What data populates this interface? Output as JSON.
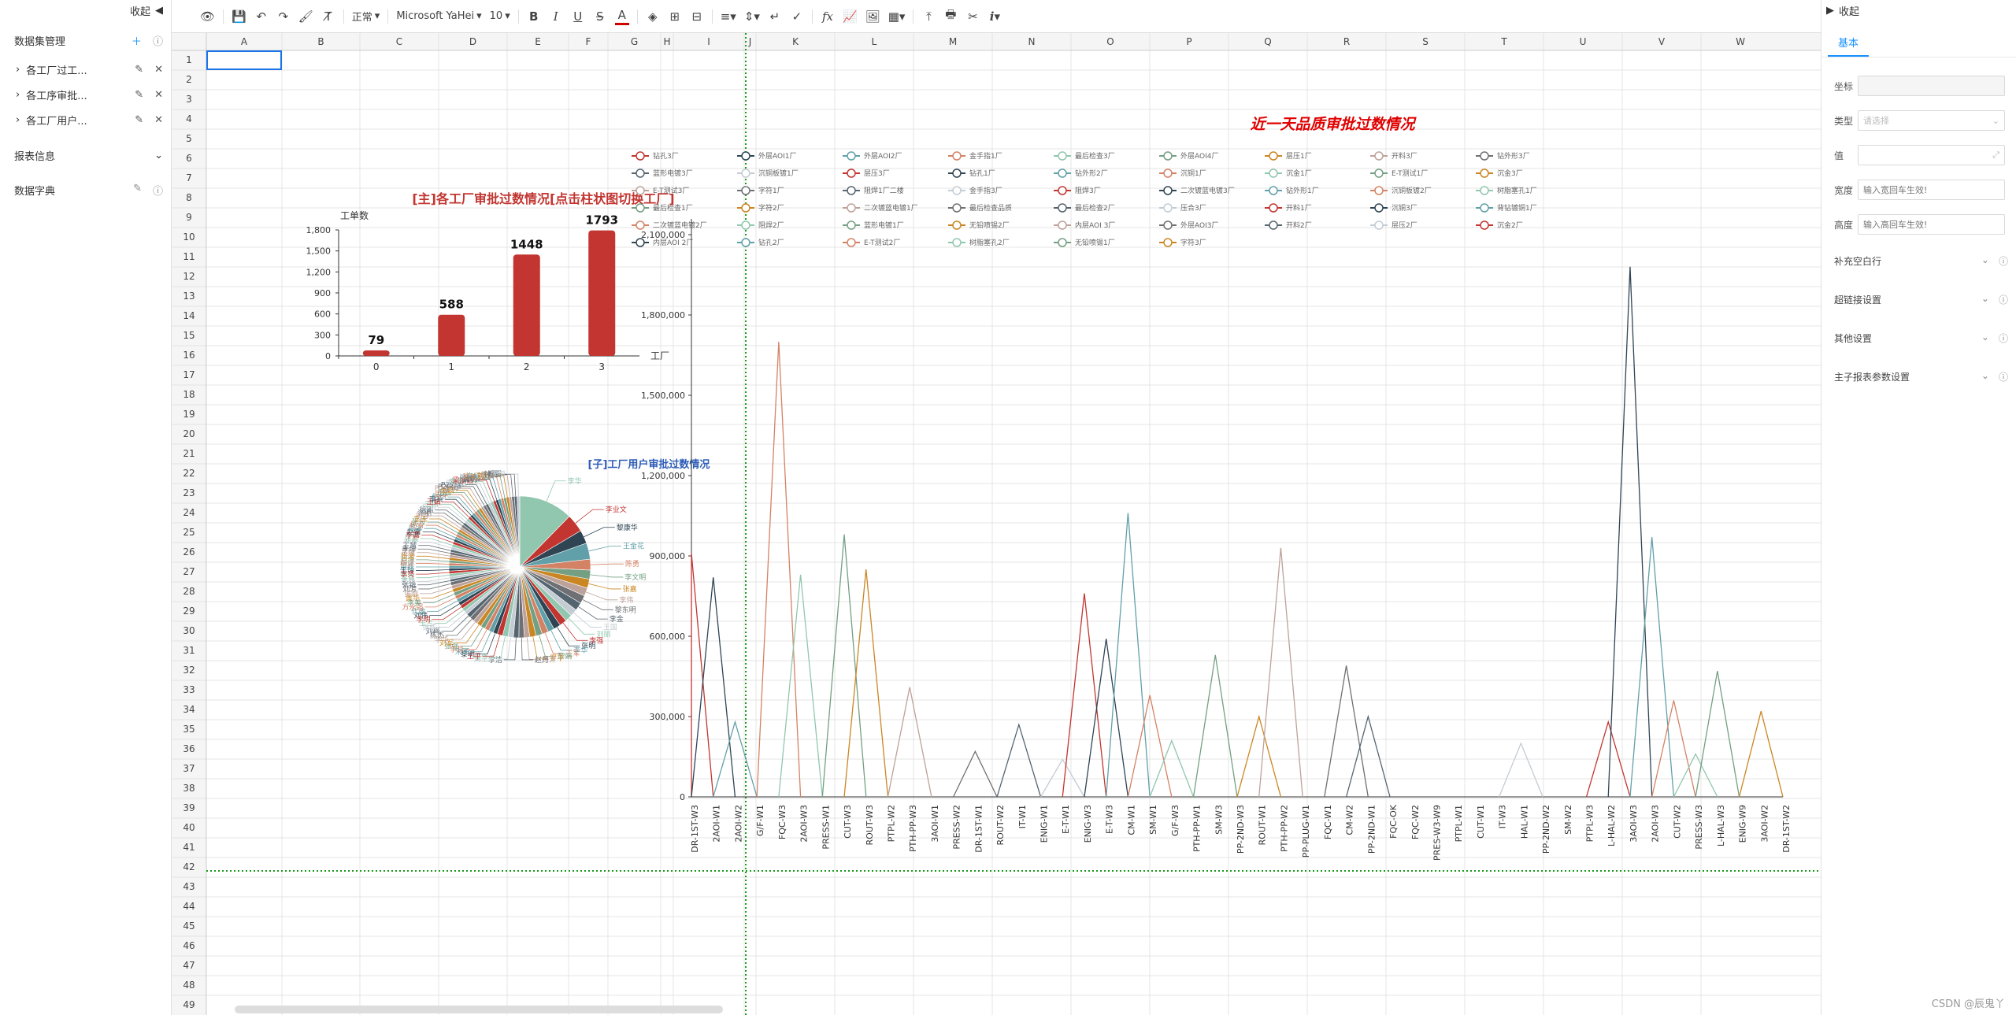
{
  "left_panel": {
    "collapse_label": "收起",
    "dataset_title": "数据集管理",
    "datasets": [
      {
        "label": "各工厂过工..."
      },
      {
        "label": "各工序审批..."
      },
      {
        "label": "各工厂用户..."
      }
    ],
    "report_info": "报表信息",
    "dict": "数据字典"
  },
  "toolbar": {
    "style": "正常",
    "font": "Microsoft YaHei",
    "size": "10"
  },
  "sheet": {
    "columns": [
      "A",
      "B",
      "C",
      "D",
      "E",
      "F",
      "G",
      "H",
      "I",
      "J",
      "K",
      "L",
      "M",
      "N",
      "O",
      "P",
      "Q",
      "R",
      "S",
      "T",
      "U",
      "V",
      "W"
    ],
    "rows": [
      "1",
      "2",
      "3",
      "4",
      "5",
      "6",
      "7",
      "8",
      "9",
      "10",
      "11",
      "12",
      "13",
      "14",
      "15",
      "16",
      "17",
      "18",
      "19",
      "20",
      "21",
      "22",
      "23",
      "24",
      "25",
      "26",
      "27",
      "28",
      "29",
      "30",
      "31",
      "32",
      "33",
      "34",
      "35",
      "36",
      "37",
      "38",
      "39",
      "40",
      "41",
      "42",
      "43",
      "44",
      "45",
      "46",
      "47",
      "48",
      "49"
    ]
  },
  "bar_chart": {
    "title": "[主]各工厂审批过数情况[点击柱状图切换工厂]",
    "ylabel": "工单数",
    "xlabel": "工厂",
    "categories": [
      "0",
      "1",
      "2",
      "3"
    ],
    "values": [
      79,
      588,
      1448,
      1793
    ],
    "value_labels": [
      "79",
      "588",
      "1448",
      "1793"
    ],
    "yticks": [
      "0",
      "300",
      "600",
      "900",
      "1,200",
      "1,500",
      "1,800"
    ],
    "ymax": 1800,
    "color": "#c23531"
  },
  "pie_chart": {
    "title": "[子]工厂用户审批过数情况",
    "labels": [
      "李华",
      "李业文",
      "黎康华",
      "王金花",
      "陈勇",
      "李文明",
      "张嘉",
      "李伟",
      "黎东明",
      "李金",
      "王国",
      "刘丽",
      "李强",
      "张明",
      "李华",
      "王军",
      "黎娟",
      "罗平",
      "黄芳",
      "赵丹",
      "李洁",
      "刘三秀",
      "张华",
      "王平",
      "黎明",
      "宋军",
      "李月",
      "张强",
      "刘军",
      "李华",
      "陈杰",
      "刘梅",
      "张成",
      "王兰",
      "李明",
      "刘伟",
      "代敢",
      "方永强",
      "李美",
      "黄华",
      "张刚",
      "刘芳",
      "张艳",
      "李静",
      "黎青",
      "李亮",
      "王玲",
      "周磊",
      "杨洋",
      "刘洋",
      "张波",
      "吴敏",
      "李坤",
      "王慧",
      "李杰",
      "张晨",
      "李露",
      "赵雷",
      "周冰",
      "杨雪",
      "张可",
      "李玉",
      "刘静",
      "许明",
      "徐刚",
      "何丽",
      "王伟",
      "王娟",
      "李兵",
      "赵华",
      "周军",
      "田鑫",
      "张霞",
      "P2测试",
      "P2内部",
      "P2外部",
      "廖春兰",
      "李大伟",
      "梁丽霞",
      "黄明",
      "张冬梅",
      "黎美玉",
      "许红华",
      "刘丹",
      "黄磊",
      "钟燕",
      "郑强",
      "李丽"
    ],
    "values": [
      60,
      20,
      15,
      18,
      12,
      10,
      10,
      9,
      9,
      9,
      8,
      8,
      8,
      8,
      7,
      7,
      7,
      7,
      6,
      6,
      6,
      6,
      6,
      6,
      5,
      5,
      5,
      5,
      5,
      5,
      5,
      5,
      4,
      4,
      4,
      4,
      4,
      4,
      4,
      4,
      4,
      4,
      3,
      3,
      3,
      3,
      3,
      3,
      3,
      3,
      3,
      3,
      3,
      3,
      3,
      3,
      3,
      3,
      3,
      3,
      3,
      3,
      3,
      3,
      3,
      3,
      3,
      3,
      3,
      3,
      3,
      3,
      3,
      3,
      3,
      3,
      3,
      3,
      3,
      3,
      3,
      3,
      3,
      3,
      3,
      3,
      3,
      3
    ],
    "colors": [
      "#91c7ae",
      "#c23531",
      "#2f4554",
      "#61a0a8",
      "#d48265",
      "#749f83",
      "#ca8622",
      "#bda29a",
      "#6e7074",
      "#546570",
      "#c4ccd3"
    ]
  },
  "line_chart": {
    "title": "近一天品质审批过数情况",
    "ytick_labels": [
      "0",
      "300,000",
      "600,000",
      "900,000",
      "1,200,000",
      "1,500,000",
      "1,800,000",
      "2,100,000"
    ],
    "ymax": 2100000,
    "x_categories": [
      "DR-1ST-W3",
      "2AOI-W1",
      "2AOI-W2",
      "G/F-W1",
      "FQC-W3",
      "2AOI-W3",
      "PRESS-W1",
      "CUT-W3",
      "ROUT-W3",
      "PTPL-W2",
      "PTH-PP-W3",
      "3AOI-W1",
      "PRESS-W2",
      "DR-1ST-W1",
      "ROUT-W2",
      "IT-W1",
      "ENIG-W1",
      "E-T-W1",
      "ENIG-W3",
      "E-T-W3",
      "CM-W1",
      "SM-W1",
      "G/F-W3",
      "PTH-PP-W1",
      "SM-W3",
      "PP-2ND-W3",
      "ROUT-W1",
      "PTH-PP-W2",
      "PP-PLUG-W1",
      "FQC-W1",
      "CM-W2",
      "PP-2ND-W1",
      "FQC-OK",
      "FQC-W2",
      "PRES-W3-W9",
      "PTPL-W1",
      "CUT-W1",
      "IT-W3",
      "HAL-W1",
      "PP-2ND-W2",
      "SM-W2",
      "PTPL-W3",
      "L-HAL-W2",
      "3AOI-W3",
      "2AOI-W3",
      "CUT-W2",
      "PRESS-W3",
      "L-HAL-W3",
      "ENIG-W9",
      "3AOI-W2",
      "DR-1ST-W2"
    ],
    "legend": [
      "钻孔3厂",
      "外层AOI1厂",
      "外层AOI2厂",
      "金手指1厂",
      "最后检查3厂",
      "外层AOI4厂",
      "层压1厂",
      "开料3厂",
      "钻外形3厂",
      "蓝形电镀3厂",
      "沉铜板镀1厂",
      "层压3厂",
      "钻孔1厂",
      "钻外形2厂",
      "沉铜1厂",
      "沉金1厂",
      "E-T测试1厂",
      "沉金3厂",
      "E-T测试3厂",
      "字符1厂",
      "阻焊1厂二楼",
      "金手指3厂",
      "阻焊3厂",
      "二次镀蓝电镀3厂",
      "钻外形1厂",
      "沉铜板镀2厂",
      "树脂塞孔1厂",
      "最后检查1厂",
      "字符2厂",
      "二次镀蓝电镀1厂",
      "最后检查品质",
      "最后检查2厂",
      "压合3厂",
      "开料1厂",
      "沉铜3厂",
      "背钻镀铜1厂",
      "二次镀蓝电镀2厂",
      "阻焊2厂",
      "蓝形电镀1厂",
      "无铅喷锡2厂",
      "内层AOI 3厂",
      "外层AOI3厂",
      "开料2厂",
      "层压2厂",
      "沉金2厂",
      "内层AOI 2厂",
      "钻孔2厂",
      "E-T测试2厂",
      "树脂塞孔2厂",
      "无铅喷锡1厂",
      "字符3厂"
    ],
    "colors": [
      "#c23531",
      "#2f4554",
      "#61a0a8",
      "#d48265",
      "#91c7ae",
      "#749f83",
      "#ca8622",
      "#bda29a",
      "#6e7074",
      "#546570",
      "#c4ccd3"
    ],
    "series": [
      {
        "peak_index": 0,
        "value": 910000
      },
      {
        "peak_index": 1,
        "value": 820000
      },
      {
        "peak_index": 2,
        "value": 280000
      },
      {
        "peak_index": 4,
        "value": 1700000
      },
      {
        "peak_index": 5,
        "value": 830000
      },
      {
        "peak_index": 7,
        "value": 980000
      },
      {
        "peak_index": 8,
        "value": 850000
      },
      {
        "peak_index": 10,
        "value": 410000
      },
      {
        "peak_index": 13,
        "value": 170000
      },
      {
        "peak_index": 15,
        "value": 270000
      },
      {
        "peak_index": 17,
        "value": 140000
      },
      {
        "peak_index": 18,
        "value": 760000
      },
      {
        "peak_index": 19,
        "value": 590000
      },
      {
        "peak_index": 20,
        "value": 1060000
      },
      {
        "peak_index": 21,
        "value": 380000
      },
      {
        "peak_index": 22,
        "value": 210000
      },
      {
        "peak_index": 24,
        "value": 530000
      },
      {
        "peak_index": 26,
        "value": 300000
      },
      {
        "peak_index": 27,
        "value": 930000
      },
      {
        "peak_index": 30,
        "value": 490000
      },
      {
        "peak_index": 31,
        "value": 300000
      },
      {
        "peak_index": 38,
        "value": 200000
      },
      {
        "peak_index": 42,
        "value": 280000
      },
      {
        "peak_index": 43,
        "value": 1980000
      },
      {
        "peak_index": 44,
        "value": 970000
      },
      {
        "peak_index": 45,
        "value": 360000
      },
      {
        "peak_index": 46,
        "value": 160000
      },
      {
        "peak_index": 47,
        "value": 470000
      },
      {
        "peak_index": 49,
        "value": 320000
      }
    ]
  },
  "right_panel": {
    "collapse_label": "收起",
    "tab": "基本",
    "coord_label": "坐标",
    "type_label": "类型",
    "type_placeholder": "请选择",
    "value_label": "值",
    "width_label": "宽度",
    "width_placeholder": "输入宽回车生效!",
    "height_label": "高度",
    "height_placeholder": "输入高回车生效!",
    "sections": [
      "补充空白行",
      "超链接设置",
      "其他设置",
      "主子报表参数设置"
    ]
  },
  "watermark": "CSDN @辰鬼丫"
}
